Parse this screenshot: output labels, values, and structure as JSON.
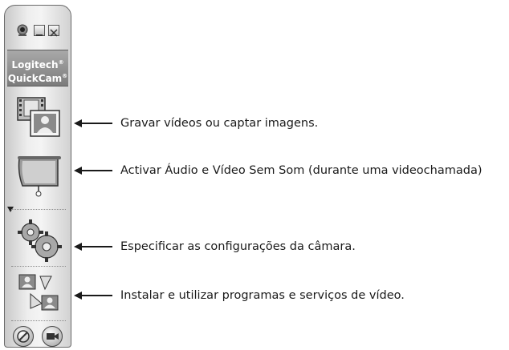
{
  "app": {
    "logo_line1": "Logitech",
    "logo_line2": "QuickCam",
    "logo_mark_line1": "®",
    "logo_mark_line2": "®"
  },
  "toolbar": {
    "buttons": [
      {
        "icon": "film-camera-icon"
      },
      {
        "icon": "screen-projector-icon"
      },
      {
        "icon": "gears-icon"
      },
      {
        "icon": "video-services-icon"
      }
    ],
    "bottom_buttons": [
      {
        "icon": "help-icon"
      },
      {
        "icon": "video-camera-icon"
      }
    ]
  },
  "callouts": [
    {
      "text": "Gravar vídeos ou captar imagens."
    },
    {
      "text": "Activar Áudio e Vídeo Sem Som (durante uma videochamada)"
    },
    {
      "text": "Especificar as configurações da câmara."
    },
    {
      "text": "Instalar e utilizar programas e serviços de vídeo."
    }
  ],
  "colors": {
    "toolbar_border": "#6a6a6a",
    "logo_bg": "#8e8e8e",
    "text": "#1a1a1a"
  }
}
